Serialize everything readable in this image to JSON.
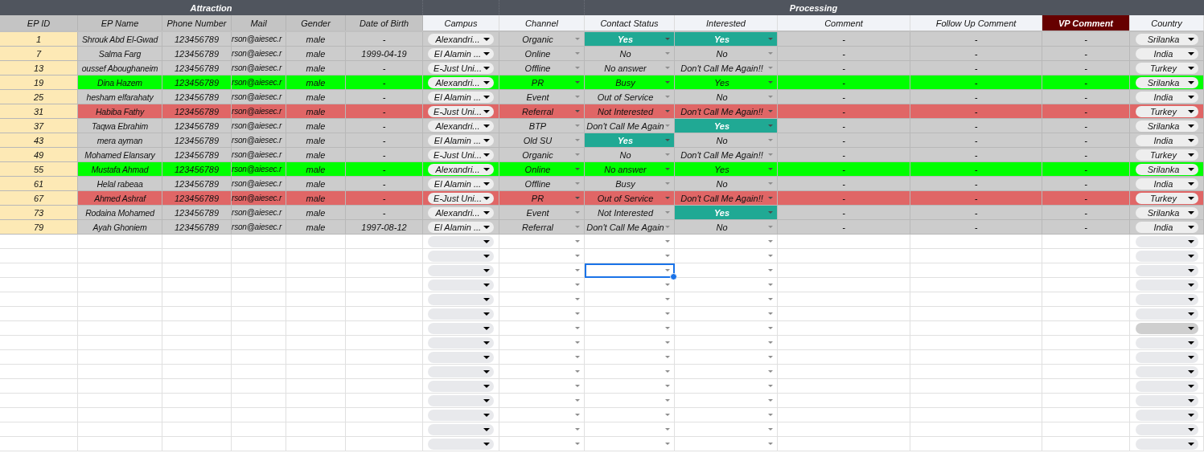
{
  "groups": [
    {
      "label": "Attraction"
    },
    {
      "label": "Processing"
    }
  ],
  "columns": [
    {
      "label": "EP ID",
      "shaded": true,
      "highlighted": false
    },
    {
      "label": "EP Name",
      "shaded": true,
      "highlighted": false
    },
    {
      "label": "Phone Number",
      "shaded": true,
      "highlighted": false
    },
    {
      "label": "Mail",
      "shaded": true,
      "highlighted": false
    },
    {
      "label": "Gender",
      "shaded": true,
      "highlighted": false
    },
    {
      "label": "Date of Birth",
      "shaded": true,
      "highlighted": false
    },
    {
      "label": "Campus",
      "shaded": false,
      "highlighted": false
    },
    {
      "label": "Channel",
      "shaded": false,
      "highlighted": false
    },
    {
      "label": "Contact Status",
      "shaded": false,
      "highlighted": false
    },
    {
      "label": "Interested",
      "shaded": false,
      "highlighted": false
    },
    {
      "label": "Comment",
      "shaded": false,
      "highlighted": false
    },
    {
      "label": "Follow Up Comment",
      "shaded": false,
      "highlighted": false
    },
    {
      "label": "VP Comment",
      "shaded": false,
      "highlighted": true
    },
    {
      "label": "Country",
      "shaded": false,
      "highlighted": false
    }
  ],
  "rows": [
    {
      "ep_id": "1",
      "name": "Shrouk Abd El-Gwad",
      "phone": "123456789",
      "mail": "rson@aiesec.r",
      "gender": "male",
      "dob": "-",
      "campus": "Alexandri...",
      "channel": "Organic",
      "contact_status": "Yes",
      "contact_status_highlighted": true,
      "interested": "Yes",
      "interested_highlighted": true,
      "comment": "-",
      "follow_up": "-",
      "vp_comment": "-",
      "country": "Srilanka",
      "color": "#cccccc"
    },
    {
      "ep_id": "7",
      "name": "Salma Farg",
      "phone": "123456789",
      "mail": "rson@aiesec.r",
      "gender": "male",
      "dob": "1999-04-19",
      "campus": "El Alamin ...",
      "channel": "Online",
      "contact_status": "No",
      "contact_status_highlighted": false,
      "interested": "No",
      "interested_highlighted": false,
      "comment": "-",
      "follow_up": "-",
      "vp_comment": "-",
      "country": "India",
      "color": "#cccccc"
    },
    {
      "ep_id": "13",
      "name": "oussef Aboughaneim",
      "phone": "123456789",
      "mail": "rson@aiesec.r",
      "gender": "male",
      "dob": "-",
      "campus": "E-Just Uni...",
      "channel": "Offline",
      "contact_status": "No answer",
      "contact_status_highlighted": false,
      "interested": "Don't Call Me Again!!",
      "interested_highlighted": false,
      "comment": "-",
      "follow_up": "-",
      "vp_comment": "-",
      "country": "Turkey",
      "color": "#cccccc"
    },
    {
      "ep_id": "19",
      "name": "Dina Hazem",
      "phone": "123456789",
      "mail": "rson@aiesec.r",
      "gender": "male",
      "dob": "-",
      "campus": "Alexandri...",
      "channel": "PR",
      "contact_status": "Busy",
      "contact_status_highlighted": false,
      "interested": "Yes",
      "interested_highlighted": false,
      "comment": "-",
      "follow_up": "-",
      "vp_comment": "-",
      "country": "Srilanka",
      "color": "#00ff00"
    },
    {
      "ep_id": "25",
      "name": "hesham elfarahaty",
      "phone": "123456789",
      "mail": "rson@aiesec.r",
      "gender": "male",
      "dob": "-",
      "campus": "El Alamin ...",
      "channel": "Event",
      "contact_status": "Out of Service",
      "contact_status_highlighted": false,
      "interested": "No",
      "interested_highlighted": false,
      "comment": "-",
      "follow_up": "-",
      "vp_comment": "-",
      "country": "India",
      "color": "#cccccc"
    },
    {
      "ep_id": "31",
      "name": "Habiba Fathy",
      "phone": "123456789",
      "mail": "rson@aiesec.r",
      "gender": "male",
      "dob": "-",
      "campus": "E-Just Uni...",
      "channel": "Referral",
      "contact_status": "Not Interested",
      "contact_status_highlighted": false,
      "interested": "Don't Call Me Again!!",
      "interested_highlighted": false,
      "comment": "-",
      "follow_up": "-",
      "vp_comment": "-",
      "country": "Turkey",
      "color": "#e06666"
    },
    {
      "ep_id": "37",
      "name": "Taqwa Ebrahim",
      "phone": "123456789",
      "mail": "rson@aiesec.r",
      "gender": "male",
      "dob": "-",
      "campus": "Alexandri...",
      "channel": "BTP",
      "contact_status": "Don't Call Me Again",
      "contact_status_highlighted": false,
      "interested": "Yes",
      "interested_highlighted": true,
      "comment": "-",
      "follow_up": "-",
      "vp_comment": "-",
      "country": "Srilanka",
      "color": "#cccccc"
    },
    {
      "ep_id": "43",
      "name": "mera ayman",
      "phone": "123456789",
      "mail": "rson@aiesec.r",
      "gender": "male",
      "dob": "-",
      "campus": "El Alamin ...",
      "channel": "Old SU",
      "contact_status": "Yes",
      "contact_status_highlighted": true,
      "interested": "No",
      "interested_highlighted": false,
      "comment": "-",
      "follow_up": "-",
      "vp_comment": "-",
      "country": "India",
      "color": "#cccccc"
    },
    {
      "ep_id": "49",
      "name": "Mohamed Elansary",
      "phone": "123456789",
      "mail": "rson@aiesec.r",
      "gender": "male",
      "dob": "-",
      "campus": "E-Just Uni...",
      "channel": "Organic",
      "contact_status": "No",
      "contact_status_highlighted": false,
      "interested": "Don't Call Me Again!!",
      "interested_highlighted": false,
      "comment": "-",
      "follow_up": "-",
      "vp_comment": "-",
      "country": "Turkey",
      "color": "#cccccc"
    },
    {
      "ep_id": "55",
      "name": "Mustafa Ahmad",
      "phone": "123456789",
      "mail": "rson@aiesec.r",
      "gender": "male",
      "dob": "-",
      "campus": "Alexandri...",
      "channel": "Online",
      "contact_status": "No answer",
      "contact_status_highlighted": false,
      "interested": "Yes",
      "interested_highlighted": false,
      "comment": "-",
      "follow_up": "-",
      "vp_comment": "-",
      "country": "Srilanka",
      "color": "#00ff00"
    },
    {
      "ep_id": "61",
      "name": "Helal rabeaa",
      "phone": "123456789",
      "mail": "rson@aiesec.r",
      "gender": "male",
      "dob": "-",
      "campus": "El Alamin ...",
      "channel": "Offline",
      "contact_status": "Busy",
      "contact_status_highlighted": false,
      "interested": "No",
      "interested_highlighted": false,
      "comment": "-",
      "follow_up": "-",
      "vp_comment": "-",
      "country": "India",
      "color": "#cccccc"
    },
    {
      "ep_id": "67",
      "name": "Ahmed Ashraf",
      "phone": "123456789",
      "mail": "rson@aiesec.r",
      "gender": "male",
      "dob": "-",
      "campus": "E-Just Uni...",
      "channel": "PR",
      "contact_status": "Out of Service",
      "contact_status_highlighted": false,
      "interested": "Don't Call Me Again!!",
      "interested_highlighted": false,
      "comment": "-",
      "follow_up": "-",
      "vp_comment": "-",
      "country": "Turkey",
      "color": "#e06666"
    },
    {
      "ep_id": "73",
      "name": "Rodaina Mohamed",
      "phone": "123456789",
      "mail": "rson@aiesec.r",
      "gender": "male",
      "dob": "-",
      "campus": "Alexandri...",
      "channel": "Event",
      "contact_status": "Not Interested",
      "contact_status_highlighted": false,
      "interested": "Yes",
      "interested_highlighted": true,
      "comment": "-",
      "follow_up": "-",
      "vp_comment": "-",
      "country": "Srilanka",
      "color": "#cccccc"
    },
    {
      "ep_id": "79",
      "name": "Ayah Ghoniem",
      "phone": "123456789",
      "mail": "rson@aiesec.r",
      "gender": "male",
      "dob": "1997-08-12",
      "campus": "El Alamin ...",
      "channel": "Referral",
      "contact_status": "Don't Call Me Again",
      "contact_status_highlighted": false,
      "interested": "No",
      "interested_highlighted": false,
      "comment": "-",
      "follow_up": "-",
      "vp_comment": "-",
      "country": "India",
      "color": "#cccccc"
    }
  ],
  "empty_rows": [
    {
      "contact_selected": false,
      "country_hovered": false
    },
    {
      "contact_selected": false,
      "country_hovered": false
    },
    {
      "contact_selected": true,
      "country_hovered": false
    },
    {
      "contact_selected": false,
      "country_hovered": false
    },
    {
      "contact_selected": false,
      "country_hovered": false
    },
    {
      "contact_selected": false,
      "country_hovered": false
    },
    {
      "contact_selected": false,
      "country_hovered": true
    },
    {
      "contact_selected": false,
      "country_hovered": false
    },
    {
      "contact_selected": false,
      "country_hovered": false
    },
    {
      "contact_selected": false,
      "country_hovered": false
    },
    {
      "contact_selected": false,
      "country_hovered": false
    },
    {
      "contact_selected": false,
      "country_hovered": false
    },
    {
      "contact_selected": false,
      "country_hovered": false
    },
    {
      "contact_selected": false,
      "country_hovered": false
    },
    {
      "contact_selected": false,
      "country_hovered": false
    }
  ]
}
